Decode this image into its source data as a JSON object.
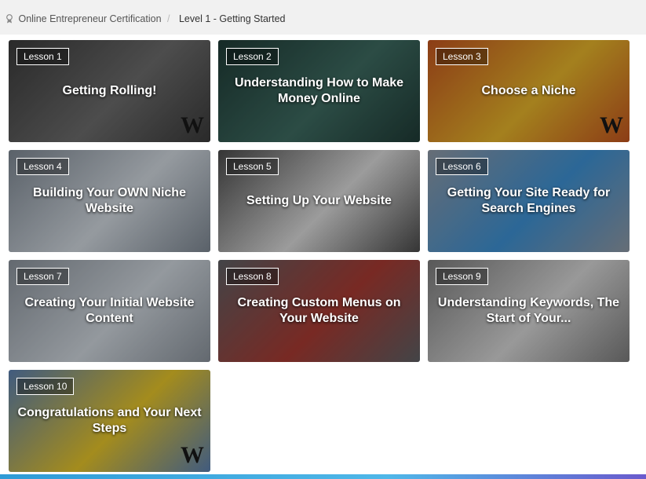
{
  "breadcrumb": {
    "root": "Online Entrepreneur Certification",
    "separator": "/",
    "current": "Level 1 - Getting Started"
  },
  "lessons": [
    {
      "badge": "Lesson 1",
      "title": "Getting Rolling!",
      "bg": "#3a3a3a",
      "accent": "#6b6b6b"
    },
    {
      "badge": "Lesson 2",
      "title": "Understanding How to Make Money Online",
      "bg": "#1f3b36",
      "accent": "#3d6a60"
    },
    {
      "badge": "Lesson 3",
      "title": "Choose a Niche",
      "bg": "#c2541f",
      "accent": "#e3b22a"
    },
    {
      "badge": "Lesson 4",
      "title": "Building Your OWN Niche Website",
      "bg": "#7d8792",
      "accent": "#cfd6dd"
    },
    {
      "badge": "Lesson 5",
      "title": "Setting Up Your Website",
      "bg": "#4a4a4a",
      "accent": "#d8d8d8"
    },
    {
      "badge": "Lesson 6",
      "title": "Getting Your Site Ready for Search Engines",
      "bg": "#8e98a4",
      "accent": "#3d8fd1"
    },
    {
      "badge": "Lesson 7",
      "title": "Creating Your Initial Website Content",
      "bg": "#8a929b",
      "accent": "#cdd4db"
    },
    {
      "badge": "Lesson 8",
      "title": "Creating Custom Menus on Your Website",
      "bg": "#5d5f63",
      "accent": "#a73a32"
    },
    {
      "badge": "Lesson 9",
      "title": "Understanding Keywords, The Start of Your...",
      "bg": "#7b7b7b",
      "accent": "#d4d4d4"
    },
    {
      "badge": "Lesson 10",
      "title": "Congratulations and Your Next Steps",
      "bg": "#5a7fb0",
      "accent": "#e3c229"
    }
  ],
  "logo_text": "W"
}
